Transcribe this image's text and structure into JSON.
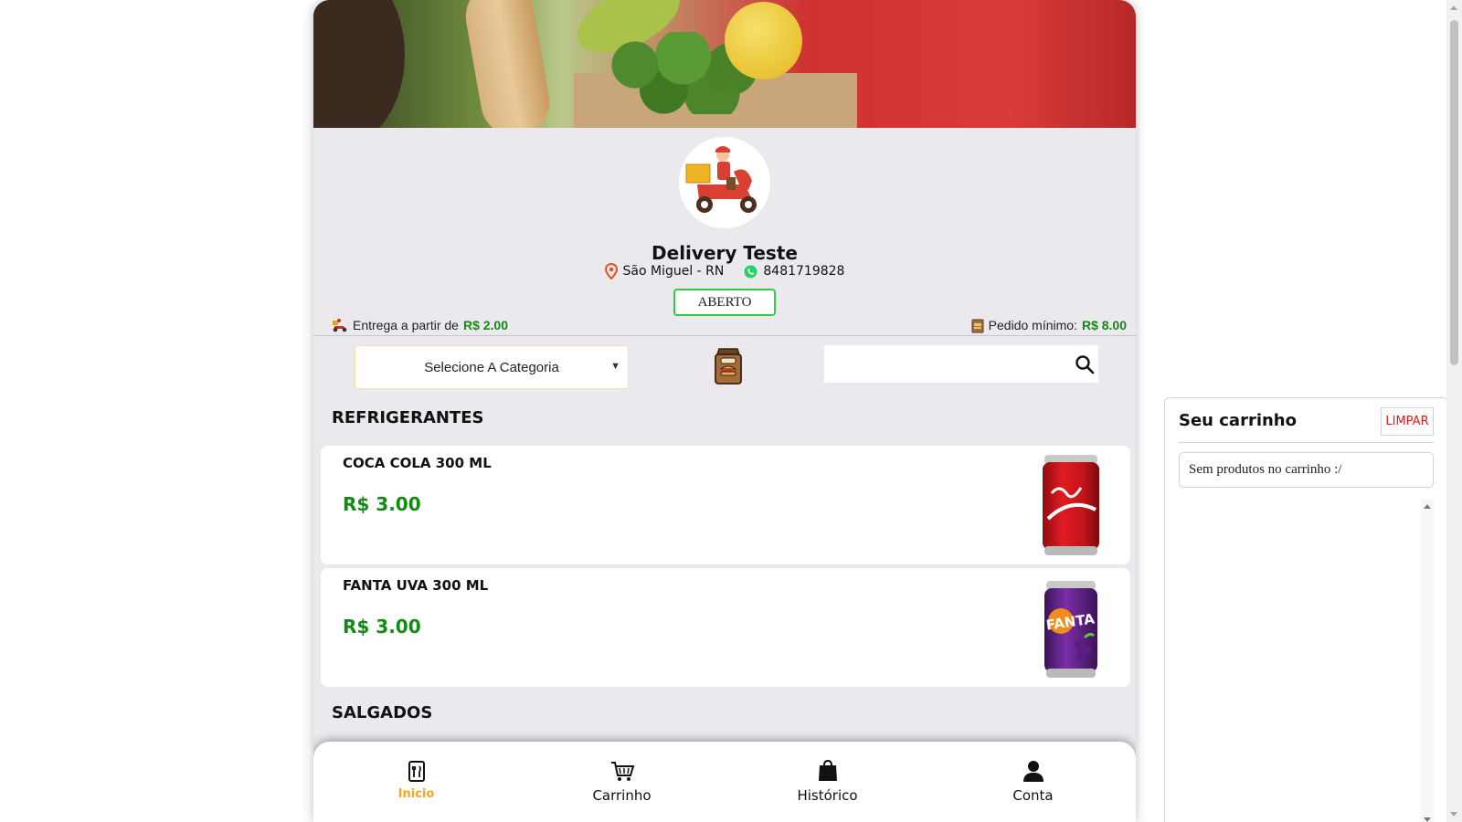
{
  "store": {
    "name": "Delivery Teste",
    "location": "São Miguel - RN",
    "phone": "8481719828",
    "status": "ABERTO",
    "delivery_label": "Entrega a partir de",
    "delivery_fee": "R$ 2.00",
    "min_order_label": "Pedido mínimo:",
    "min_order": "R$ 8.00"
  },
  "filters": {
    "category_placeholder": "Selecione A Categoria",
    "search_value": ""
  },
  "sections": [
    {
      "title": "REFRIGERANTES",
      "products": [
        {
          "name": "COCA COLA 300 ML",
          "price": "R$ 3.00",
          "image_icon": "coca-cola-can-icon"
        },
        {
          "name": "FANTA UVA 300 ML",
          "price": "R$ 3.00",
          "image_icon": "fanta-uva-can-icon"
        }
      ]
    },
    {
      "title": "SALGADOS",
      "products": []
    }
  ],
  "nav": {
    "items": [
      {
        "label": "Inicio",
        "icon": "menu-utensils-icon",
        "active": true
      },
      {
        "label": "Carrinho",
        "icon": "cart-icon",
        "active": false
      },
      {
        "label": "Histórico",
        "icon": "shopping-bag-icon",
        "active": false
      },
      {
        "label": "Conta",
        "icon": "user-icon",
        "active": false
      }
    ]
  },
  "cart": {
    "title": "Seu carrinho",
    "clear_label": "LIMPAR",
    "empty_text": "Sem produtos no carrinho :/"
  },
  "colors": {
    "accent_green": "#138a13",
    "status_border": "#2ecc40",
    "nav_active": "#f5a623",
    "clear_red": "#e01919",
    "background": "#ebe9ee"
  }
}
